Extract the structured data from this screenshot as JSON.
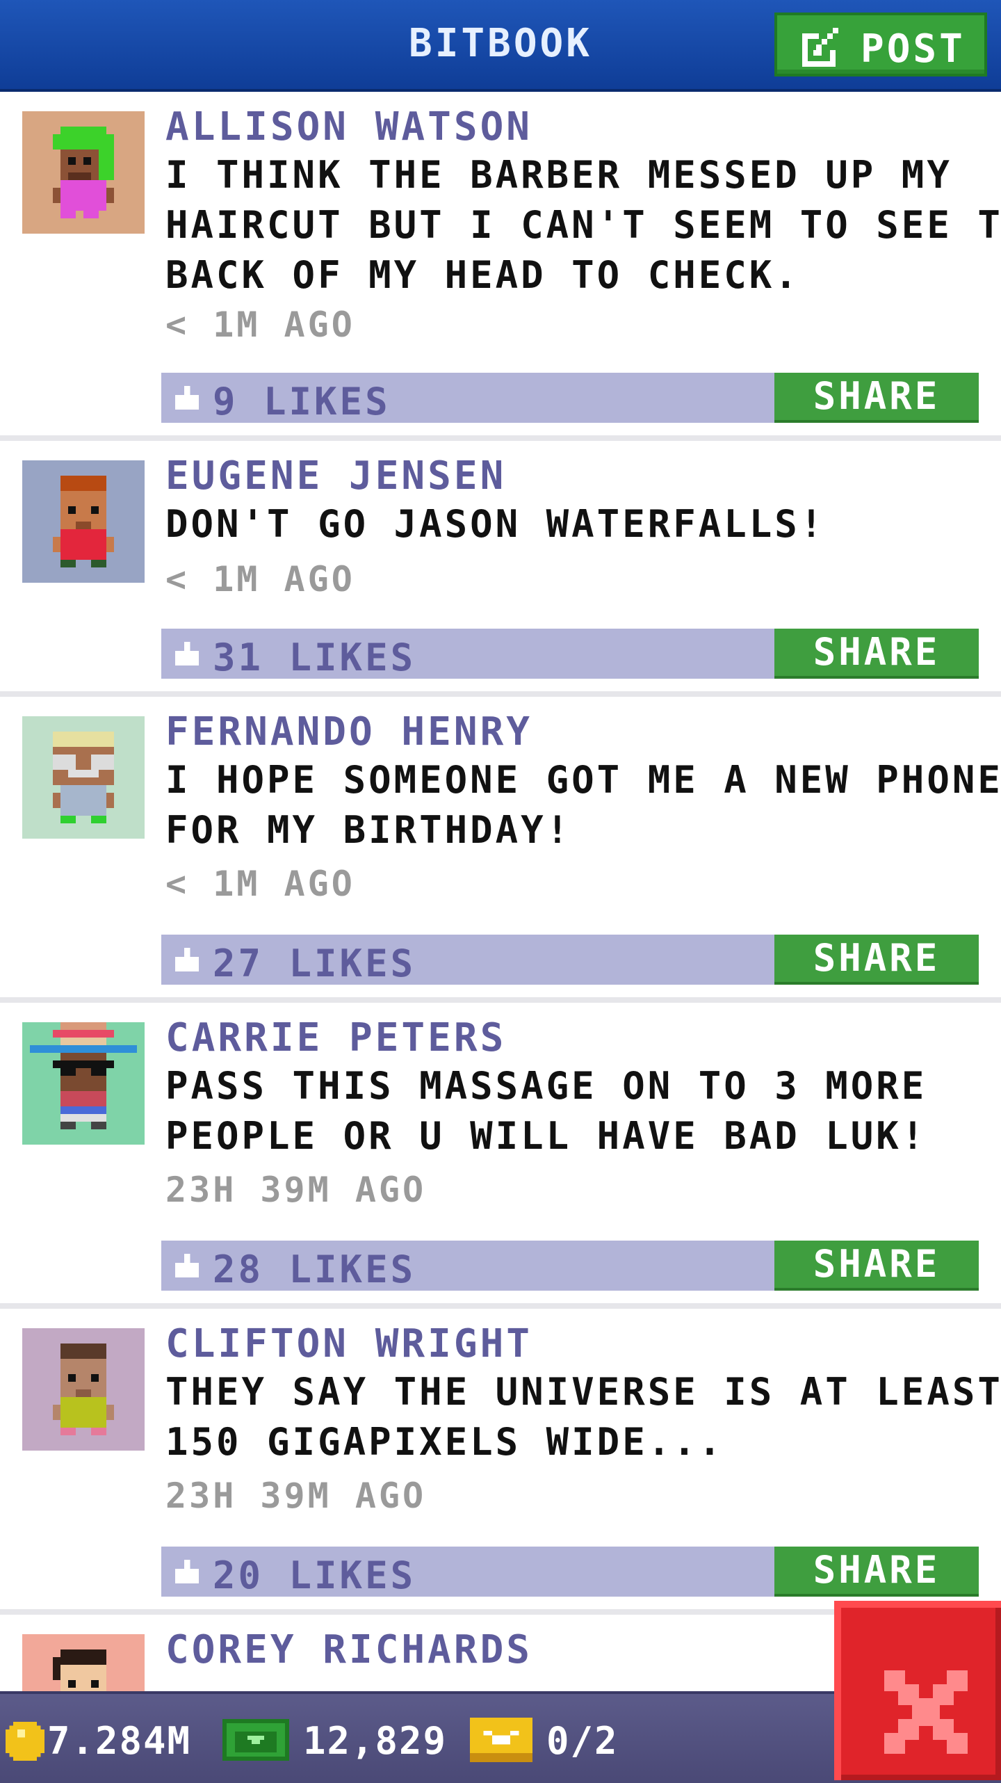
{
  "header": {
    "title": "BITBOOK",
    "post_button_label": "POST"
  },
  "feed": {
    "posts": [
      {
        "author": "ALLISON WATSON",
        "avatar_icon": "avatar-green-hair-icon",
        "avatar_bg": "#d8a682",
        "message_lines": [
          "I THINK THE BARBER MESSED UP MY",
          "HAIRCUT BUT I CAN'T SEEM TO SEE THE",
          "BACK OF MY HEAD TO CHECK."
        ],
        "time": "< 1M AGO",
        "likes": "9 LIKES",
        "share_label": "SHARE"
      },
      {
        "author": "EUGENE JENSEN",
        "avatar_icon": "avatar-red-shirt-icon",
        "avatar_bg": "#98a4c4",
        "message_lines": [
          "DON'T GO JASON WATERFALLS!"
        ],
        "time": "< 1M AGO",
        "likes": "31 LIKES",
        "share_label": "SHARE"
      },
      {
        "author": "FERNANDO HENRY",
        "avatar_icon": "avatar-glasses-icon",
        "avatar_bg": "#bfdfc9",
        "message_lines": [
          "I HOPE SOMEONE GOT ME A NEW PHONE",
          "FOR MY BIRTHDAY!"
        ],
        "time": "< 1M AGO",
        "likes": "27 LIKES",
        "share_label": "SHARE"
      },
      {
        "author": "CARRIE PETERS",
        "avatar_icon": "avatar-sombrero-icon",
        "avatar_bg": "#7fd3a8",
        "message_lines": [
          "PASS THIS MASSAGE ON TO 3 MORE",
          "PEOPLE OR U WILL HAVE BAD LUK!"
        ],
        "time": "23H 39M AGO",
        "likes": "28 LIKES",
        "share_label": "SHARE"
      },
      {
        "author": "CLIFTON WRIGHT",
        "avatar_icon": "avatar-yellow-shirt-icon",
        "avatar_bg": "#c2a9c4",
        "message_lines": [
          "THEY SAY THE UNIVERSE IS AT LEAST",
          "150 GIGAPIXELS WIDE..."
        ],
        "time": "23H 39M AGO",
        "likes": "20 LIKES",
        "share_label": "SHARE"
      },
      {
        "author": "COREY RICHARDS",
        "avatar_icon": "avatar-short-hair-icon",
        "avatar_bg": "#f2a899",
        "message_lines": [],
        "time": "",
        "likes": "",
        "share_label": ""
      }
    ]
  },
  "footer": {
    "coins": "7.284M",
    "bux": "12,829",
    "tickets": "0/2",
    "coin_icon": "coin-icon",
    "bux_icon": "bux-cash-icon",
    "ticket_icon": "vip-ticket-icon"
  },
  "close_icon": "close-icon",
  "colors": {
    "header_blue": "#1a4fae",
    "post_green": "#37a23a",
    "like_bar": "#b2b4d8",
    "author_purple": "#5e5c9c",
    "close_red": "#e0242a"
  }
}
